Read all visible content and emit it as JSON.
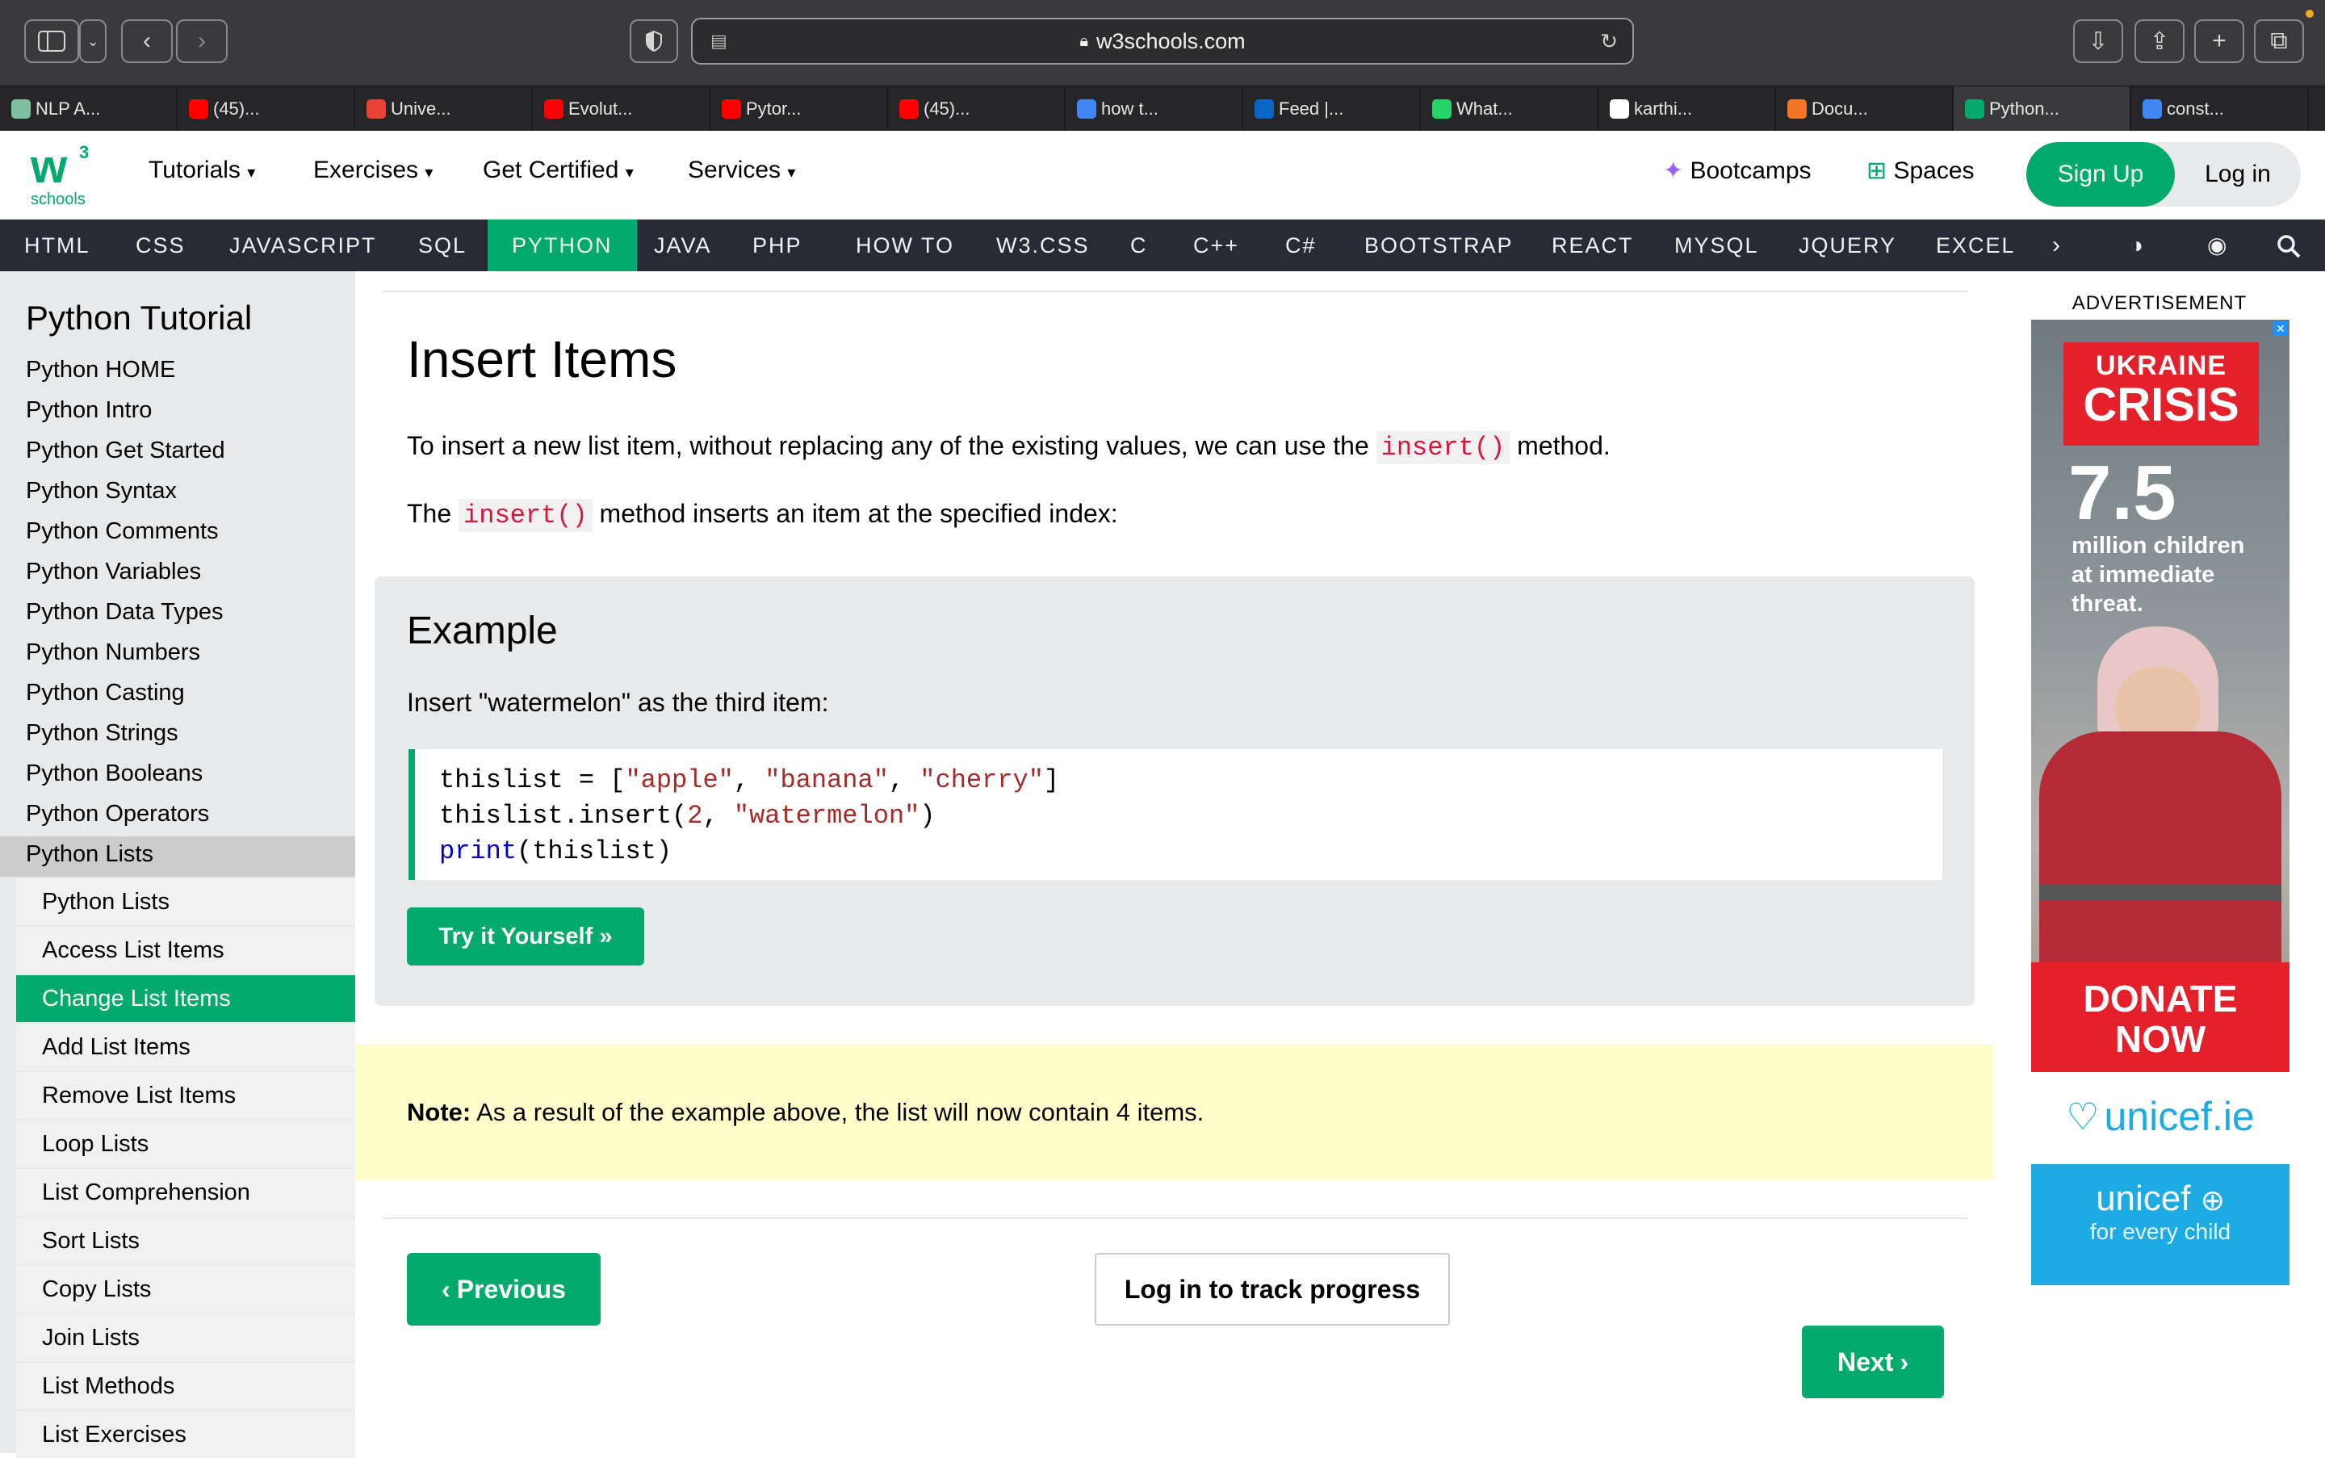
{
  "browser": {
    "url": "w3schools.com",
    "tabs": [
      {
        "title": "NLP A...",
        "color": "#7fbf9f"
      },
      {
        "title": "(45)...",
        "color": "#ff0000"
      },
      {
        "title": "Unive...",
        "color": "#ea4335"
      },
      {
        "title": "Evolut...",
        "color": "#ff0000"
      },
      {
        "title": "Pytor...",
        "color": "#ff0000"
      },
      {
        "title": "(45)...",
        "color": "#ff0000"
      },
      {
        "title": "how t...",
        "color": "#4285f4"
      },
      {
        "title": "Feed |...",
        "color": "#0a66c2"
      },
      {
        "title": "What...",
        "color": "#25d366"
      },
      {
        "title": "karthi...",
        "color": "#ffffff"
      },
      {
        "title": "Docu...",
        "color": "#f37626"
      },
      {
        "title": "Python...",
        "color": "#04aa6d"
      },
      {
        "title": "const...",
        "color": "#4285f4"
      }
    ]
  },
  "header": {
    "logo_text": "schools",
    "logo_sup": "3",
    "nav": [
      "Tutorials",
      "Exercises",
      "Get Certified",
      "Services"
    ],
    "bootcamps": "Bootcamps",
    "spaces": "Spaces",
    "signup": "Sign Up",
    "login": "Log in"
  },
  "subnav": [
    "HTML",
    "CSS",
    "JAVASCRIPT",
    "SQL",
    "PYTHON",
    "JAVA",
    "PHP",
    "HOW TO",
    "W3.CSS",
    "C",
    "C++",
    "C#",
    "BOOTSTRAP",
    "REACT",
    "MYSQL",
    "JQUERY",
    "EXCEL"
  ],
  "sidebar": {
    "title": "Python Tutorial",
    "items": [
      "Python HOME",
      "Python Intro",
      "Python Get Started",
      "Python Syntax",
      "Python Comments",
      "Python Variables",
      "Python Data Types",
      "Python Numbers",
      "Python Casting",
      "Python Strings",
      "Python Booleans",
      "Python Operators",
      "Python Lists"
    ],
    "sub_items": [
      "Python Lists",
      "Access List Items",
      "Change List Items",
      "Add List Items",
      "Remove List Items",
      "Loop Lists",
      "List Comprehension",
      "Sort Lists",
      "Copy Lists",
      "Join Lists",
      "List Methods",
      "List Exercises"
    ]
  },
  "main": {
    "heading": "Insert Items",
    "p1_before": "To insert a new list item, without replacing any of the existing values, we can use the",
    "p1_code": "insert()",
    "p1_after": "method.",
    "p2_before": "The",
    "p2_code": "insert()",
    "p2_after": "method inserts an item at the specified index:",
    "example": {
      "title": "Example",
      "desc": "Insert \"watermelon\" as the third item:",
      "code": {
        "l1_a": "thislist = [",
        "l1_s1": "\"apple\"",
        "l1_c1": ", ",
        "l1_s2": "\"banana\"",
        "l1_c2": ", ",
        "l1_s3": "\"cherry\"",
        "l1_end": "]",
        "l2_a": "thislist.insert(",
        "l2_n": "2",
        "l2_c": ", ",
        "l2_s": "\"watermelon\"",
        "l2_end": ")",
        "l3_kw": "print",
        "l3_rest": "(thislist)"
      },
      "try_button": "Try it Yourself »"
    },
    "note_label": "Note:",
    "note_text": "As a result of the example above, the list will now contain 4 items.",
    "prev_button": "Previous",
    "track_button": "Log in to track progress",
    "next_button": "Next"
  },
  "ad": {
    "label": "ADVERTISEMENT",
    "line1": "UKRAINE",
    "line2": "CRISIS",
    "stat": "7.5",
    "stat_text": "million children at immediate threat.",
    "cta1": "DONATE",
    "cta2": "NOW",
    "brand": "unicef.ie",
    "brand2": "unicef",
    "tagline": "for every child"
  }
}
